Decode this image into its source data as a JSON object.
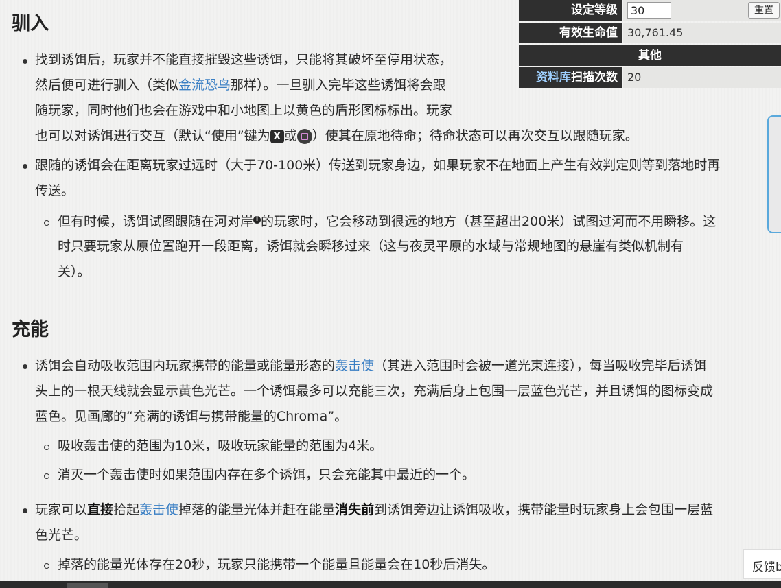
{
  "sections": {
    "tame": {
      "title": "驯入",
      "b1_l1": "找到诱饵后，玩家并不能直接摧毁这些诱饵，只能将其破坏至停用状态，",
      "b1_l2a": "然后便可进行驯入（类似",
      "b1_l2_link": "金流恐鸟",
      "b1_l2b": "那样）。一旦驯入完毕这些诱饵将会跟",
      "b1_l3": "随玩家，同时他们也会在游戏中和小地图上以黄色的盾形图标标出。玩家",
      "b1_l4a": "也可以对诱饵进行交互（默认“使用”键为",
      "b1_l4_key": "X",
      "b1_l4b": "或",
      "b1_l4c": "）使其在原地待命；待命状态可以再次交互以跟随玩家。",
      "b2_l1": "跟随的诱饵会在距离玩家过远时（大于70-100米）传送到玩家身边，如果玩家不在地面上产生有效判定则等到落地时再",
      "b2_l2": "传送。",
      "s1_l1a": "但有时候，诱饵试图跟随在河对岸",
      "s1_l1_sup": "i",
      "s1_l1b": "的玩家时，它会移动到很远的地方（甚至超出200米）试图过河而不用瞬移。这",
      "s1_l2": "时只要玩家从原位置跑开一段距离，诱饵就会瞬移过来（这与夜灵平原的水域与常规地图的悬崖有类似机制有",
      "s1_l3": "关）。"
    },
    "charge": {
      "title": "充能",
      "b1_l1a": "诱饵会自动吸收范围内玩家携带的能量或能量形态的",
      "b1_l1_link": "轰击使",
      "b1_l1b": "（其进入范围时会被一道光束连接），每当吸收完毕后诱饵",
      "b1_l2": "头上的一根天线就会显示黄色光芒。一个诱饵最多可以充能三次，充满后身上包围一层蓝色光芒，并且诱饵的图标变成",
      "b1_l3": "蓝色。见画廊的“充满的诱饵与携带能量的Chroma”。",
      "s1": "吸收轰击使的范围为10米，吸收玩家能量的范围为4米。",
      "s2": "消灭一个轰击使时如果范围内存在多个诱饵，只会充能其中最近的一个。",
      "b2_l1a": "玩家可以",
      "b2_l1_bold1": "直接",
      "b2_l1b": "拾起",
      "b2_l1_link": "轰击使",
      "b2_l1c": "掉落的能量光体并赶在能量",
      "b2_l1_bold2": "消失前",
      "b2_l1d": "到诱饵旁边让诱饵吸收，携带能量时玩家身上会包围一层蓝",
      "b2_l2": "色光芒。",
      "s3": "掉落的能量光体存在20秒，玩家只能携带一个能量且能量会在10秒后消失。"
    }
  },
  "infobox": {
    "level_label": "设定等级",
    "level_value": "30",
    "reset_label": "重置",
    "hp_label": "有效生命值",
    "hp_value": "30,761.45",
    "other_header": "其他",
    "scan_label_link": "资料库",
    "scan_label_rest": "扫描次数",
    "scan_value": "20"
  },
  "feedback_label": "反馈b",
  "colors": {
    "link": "#3a7fc4",
    "header_bg": "#2f2f2f"
  }
}
